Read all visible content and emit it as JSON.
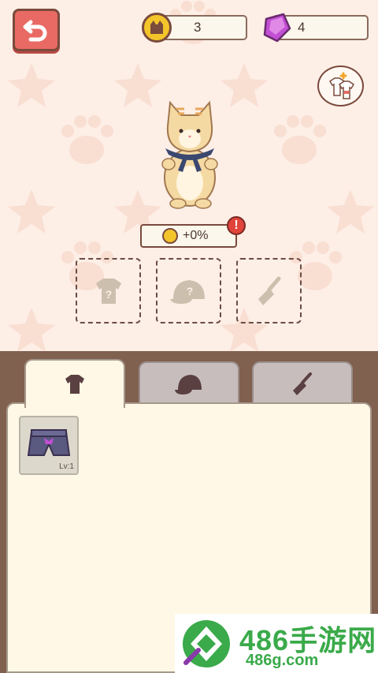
{
  "header": {
    "coins": "3",
    "gems": "4"
  },
  "character": {
    "bonus_text": "+0%",
    "alert_text": "!"
  },
  "slots": [
    {
      "name": "shirt-slot",
      "mark": "?"
    },
    {
      "name": "hat-slot",
      "mark": "?"
    },
    {
      "name": "tool-slot",
      "mark": ""
    }
  ],
  "tabs": [
    {
      "name": "shirt",
      "active": true
    },
    {
      "name": "hat",
      "active": false
    },
    {
      "name": "tool",
      "active": false
    }
  ],
  "inventory": [
    {
      "name": "purple-shorts",
      "level": "Lv:1"
    }
  ],
  "watermark": {
    "title": "486手游网",
    "site": "486g.com"
  },
  "colors": {
    "accent_red": "#e96a64",
    "coin_yellow": "#f3c52a",
    "gem_purple": "#c24fd4",
    "panel_brown": "#80604f",
    "cream": "#fff8e6",
    "brand_green": "#3aaa4a"
  }
}
